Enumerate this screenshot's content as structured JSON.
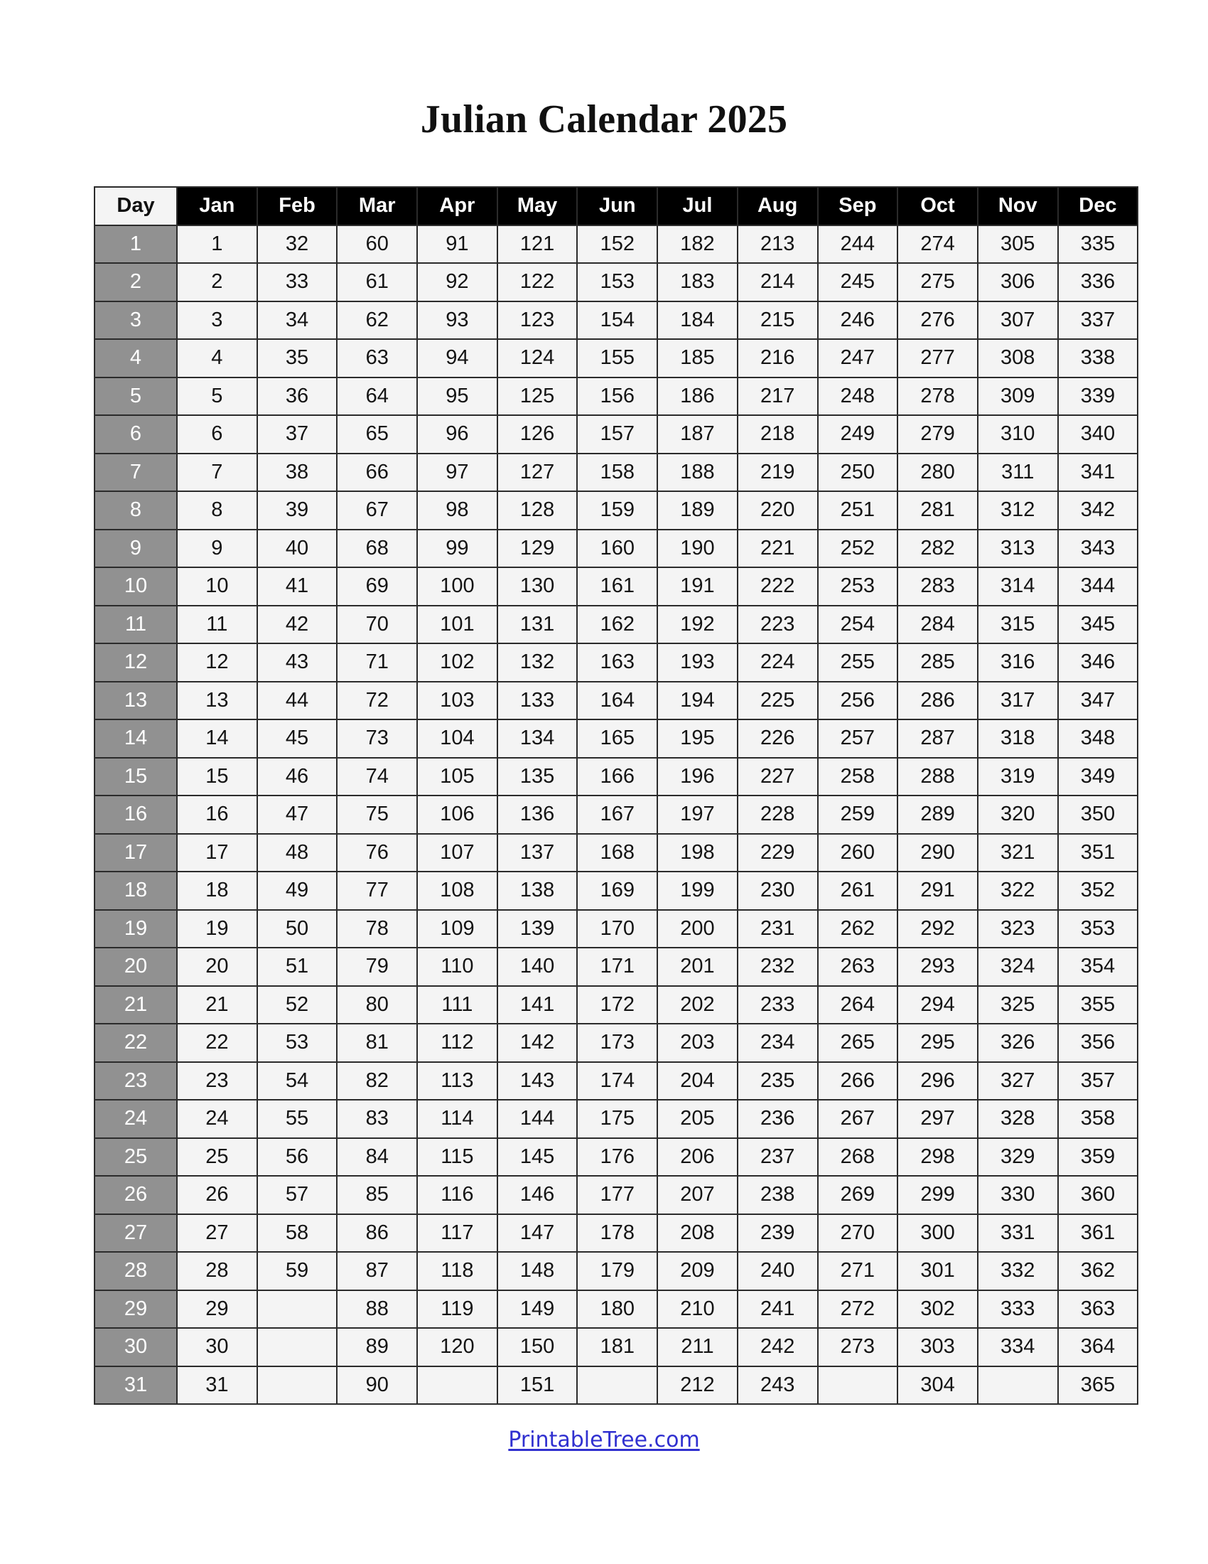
{
  "document": {
    "title": "Julian Calendar 2025"
  },
  "table": {
    "day_header": "Day",
    "month_headers": [
      "Jan",
      "Feb",
      "Mar",
      "Apr",
      "May",
      "Jun",
      "Jul",
      "Aug",
      "Sep",
      "Oct",
      "Nov",
      "Dec"
    ],
    "day_labels": [
      "1",
      "2",
      "3",
      "4",
      "5",
      "6",
      "7",
      "8",
      "9",
      "10",
      "11",
      "12",
      "13",
      "14",
      "15",
      "16",
      "17",
      "18",
      "19",
      "20",
      "21",
      "22",
      "23",
      "24",
      "25",
      "26",
      "27",
      "28",
      "29",
      "30",
      "31"
    ],
    "rows": [
      {
        "day": "1",
        "values": [
          "1",
          "32",
          "60",
          "91",
          "121",
          "152",
          "182",
          "213",
          "244",
          "274",
          "305",
          "335"
        ]
      },
      {
        "day": "2",
        "values": [
          "2",
          "33",
          "61",
          "92",
          "122",
          "153",
          "183",
          "214",
          "245",
          "275",
          "306",
          "336"
        ]
      },
      {
        "day": "3",
        "values": [
          "3",
          "34",
          "62",
          "93",
          "123",
          "154",
          "184",
          "215",
          "246",
          "276",
          "307",
          "337"
        ]
      },
      {
        "day": "4",
        "values": [
          "4",
          "35",
          "63",
          "94",
          "124",
          "155",
          "185",
          "216",
          "247",
          "277",
          "308",
          "338"
        ]
      },
      {
        "day": "5",
        "values": [
          "5",
          "36",
          "64",
          "95",
          "125",
          "156",
          "186",
          "217",
          "248",
          "278",
          "309",
          "339"
        ]
      },
      {
        "day": "6",
        "values": [
          "6",
          "37",
          "65",
          "96",
          "126",
          "157",
          "187",
          "218",
          "249",
          "279",
          "310",
          "340"
        ]
      },
      {
        "day": "7",
        "values": [
          "7",
          "38",
          "66",
          "97",
          "127",
          "158",
          "188",
          "219",
          "250",
          "280",
          "311",
          "341"
        ]
      },
      {
        "day": "8",
        "values": [
          "8",
          "39",
          "67",
          "98",
          "128",
          "159",
          "189",
          "220",
          "251",
          "281",
          "312",
          "342"
        ]
      },
      {
        "day": "9",
        "values": [
          "9",
          "40",
          "68",
          "99",
          "129",
          "160",
          "190",
          "221",
          "252",
          "282",
          "313",
          "343"
        ]
      },
      {
        "day": "10",
        "values": [
          "10",
          "41",
          "69",
          "100",
          "130",
          "161",
          "191",
          "222",
          "253",
          "283",
          "314",
          "344"
        ]
      },
      {
        "day": "11",
        "values": [
          "11",
          "42",
          "70",
          "101",
          "131",
          "162",
          "192",
          "223",
          "254",
          "284",
          "315",
          "345"
        ]
      },
      {
        "day": "12",
        "values": [
          "12",
          "43",
          "71",
          "102",
          "132",
          "163",
          "193",
          "224",
          "255",
          "285",
          "316",
          "346"
        ]
      },
      {
        "day": "13",
        "values": [
          "13",
          "44",
          "72",
          "103",
          "133",
          "164",
          "194",
          "225",
          "256",
          "286",
          "317",
          "347"
        ]
      },
      {
        "day": "14",
        "values": [
          "14",
          "45",
          "73",
          "104",
          "134",
          "165",
          "195",
          "226",
          "257",
          "287",
          "318",
          "348"
        ]
      },
      {
        "day": "15",
        "values": [
          "15",
          "46",
          "74",
          "105",
          "135",
          "166",
          "196",
          "227",
          "258",
          "288",
          "319",
          "349"
        ]
      },
      {
        "day": "16",
        "values": [
          "16",
          "47",
          "75",
          "106",
          "136",
          "167",
          "197",
          "228",
          "259",
          "289",
          "320",
          "350"
        ]
      },
      {
        "day": "17",
        "values": [
          "17",
          "48",
          "76",
          "107",
          "137",
          "168",
          "198",
          "229",
          "260",
          "290",
          "321",
          "351"
        ]
      },
      {
        "day": "18",
        "values": [
          "18",
          "49",
          "77",
          "108",
          "138",
          "169",
          "199",
          "230",
          "261",
          "291",
          "322",
          "352"
        ]
      },
      {
        "day": "19",
        "values": [
          "19",
          "50",
          "78",
          "109",
          "139",
          "170",
          "200",
          "231",
          "262",
          "292",
          "323",
          "353"
        ]
      },
      {
        "day": "20",
        "values": [
          "20",
          "51",
          "79",
          "110",
          "140",
          "171",
          "201",
          "232",
          "263",
          "293",
          "324",
          "354"
        ]
      },
      {
        "day": "21",
        "values": [
          "21",
          "52",
          "80",
          "111",
          "141",
          "172",
          "202",
          "233",
          "264",
          "294",
          "325",
          "355"
        ]
      },
      {
        "day": "22",
        "values": [
          "22",
          "53",
          "81",
          "112",
          "142",
          "173",
          "203",
          "234",
          "265",
          "295",
          "326",
          "356"
        ]
      },
      {
        "day": "23",
        "values": [
          "23",
          "54",
          "82",
          "113",
          "143",
          "174",
          "204",
          "235",
          "266",
          "296",
          "327",
          "357"
        ]
      },
      {
        "day": "24",
        "values": [
          "24",
          "55",
          "83",
          "114",
          "144",
          "175",
          "205",
          "236",
          "267",
          "297",
          "328",
          "358"
        ]
      },
      {
        "day": "25",
        "values": [
          "25",
          "56",
          "84",
          "115",
          "145",
          "176",
          "206",
          "237",
          "268",
          "298",
          "329",
          "359"
        ]
      },
      {
        "day": "26",
        "values": [
          "26",
          "57",
          "85",
          "116",
          "146",
          "177",
          "207",
          "238",
          "269",
          "299",
          "330",
          "360"
        ]
      },
      {
        "day": "27",
        "values": [
          "27",
          "58",
          "86",
          "117",
          "147",
          "178",
          "208",
          "239",
          "270",
          "300",
          "331",
          "361"
        ]
      },
      {
        "day": "28",
        "values": [
          "28",
          "59",
          "87",
          "118",
          "148",
          "179",
          "209",
          "240",
          "271",
          "301",
          "332",
          "362"
        ]
      },
      {
        "day": "29",
        "values": [
          "29",
          "",
          "88",
          "119",
          "149",
          "180",
          "210",
          "241",
          "272",
          "302",
          "333",
          "363"
        ]
      },
      {
        "day": "30",
        "values": [
          "30",
          "",
          "89",
          "120",
          "150",
          "181",
          "211",
          "242",
          "273",
          "303",
          "334",
          "364"
        ]
      },
      {
        "day": "31",
        "values": [
          "31",
          "",
          "90",
          "",
          "151",
          "",
          "212",
          "243",
          "",
          "304",
          "",
          "365"
        ]
      }
    ]
  },
  "footer": {
    "link_text": "PrintableTree.com"
  },
  "colors": {
    "header_background": "#000000",
    "header_text": "#ffffff",
    "day_header_background": "#f4f4f4",
    "day_cell_background": "#919191",
    "day_cell_text": "#ffffff",
    "cell_background": "#f4f4f4",
    "cell_text": "#141414",
    "border": "#2b2b2b",
    "link": "#3030d0",
    "page_background": "#ffffff"
  }
}
